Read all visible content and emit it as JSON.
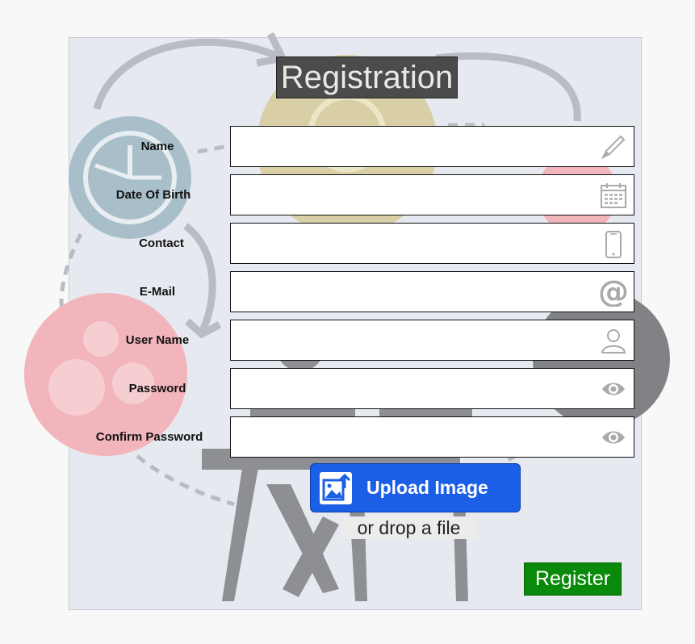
{
  "form": {
    "title": "Registration",
    "fields": [
      {
        "label": "Name",
        "value": "",
        "icon": "pencil-icon"
      },
      {
        "label": "Date Of Birth",
        "value": "",
        "icon": "calendar-icon"
      },
      {
        "label": "Contact",
        "value": "",
        "icon": "phone-icon"
      },
      {
        "label": "E-Mail",
        "value": "",
        "icon": "at-icon"
      },
      {
        "label": "User Name",
        "value": "",
        "icon": "user-icon"
      },
      {
        "label": "Password",
        "value": "",
        "icon": "eye-icon"
      },
      {
        "label": "Confirm Password",
        "value": "",
        "icon": "eye-icon"
      }
    ],
    "upload_label": "Upload Image",
    "drop_label": "or drop a file",
    "register_label": "Register"
  },
  "colors": {
    "upload_blue": "#1b5fe6",
    "register_green": "#0a8a0a",
    "title_bg": "#4b4b4b"
  }
}
